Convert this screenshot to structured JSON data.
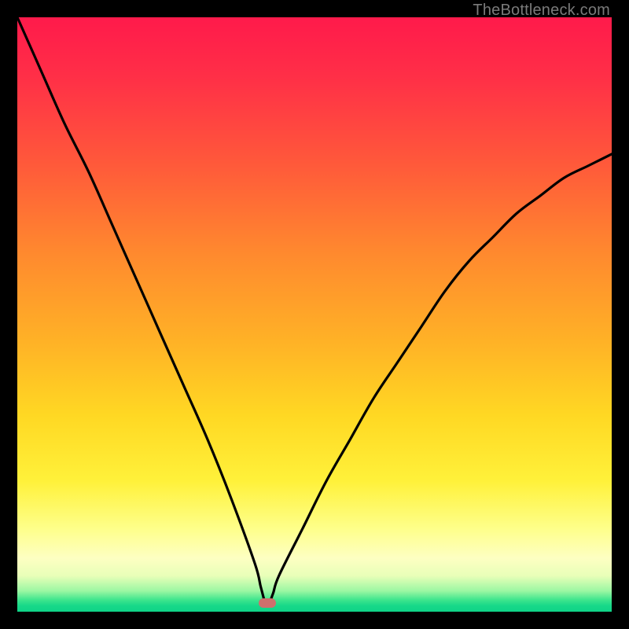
{
  "watermark": "TheBottleneck.com",
  "colors": {
    "frame": "#000000",
    "gradient_top": "#ff1a4b",
    "gradient_mid": "#fff13a",
    "gradient_bottom": "#0fd487",
    "curve": "#000000",
    "marker": "#cf6f6d"
  },
  "chart_data": {
    "type": "line",
    "title": "",
    "xlabel": "",
    "ylabel": "",
    "xlim": [
      0,
      100
    ],
    "ylim": [
      0,
      100
    ],
    "grid": false,
    "legend": false,
    "annotations": [
      {
        "type": "pill-marker",
        "x": 42,
        "y": 1.5
      }
    ],
    "series": [
      {
        "name": "bottleneck-curve",
        "x": [
          0,
          4,
          8,
          12,
          16,
          20,
          24,
          28,
          32,
          36,
          40,
          41,
          42,
          43,
          44,
          48,
          52,
          56,
          60,
          64,
          68,
          72,
          76,
          80,
          84,
          88,
          92,
          96,
          100
        ],
        "y": [
          100,
          91,
          82,
          74,
          65,
          56,
          47,
          38,
          29,
          19,
          8,
          4,
          1,
          3,
          6,
          14,
          22,
          29,
          36,
          42,
          48,
          54,
          59,
          63,
          67,
          70,
          73,
          75,
          77
        ]
      }
    ],
    "background": {
      "type": "gradient-vertical",
      "stops": [
        {
          "pos": 0,
          "color": "#ff1a4b"
        },
        {
          "pos": 55,
          "color": "#ffb326"
        },
        {
          "pos": 86,
          "color": "#feff8a"
        },
        {
          "pos": 100,
          "color": "#0fd487"
        }
      ]
    }
  }
}
